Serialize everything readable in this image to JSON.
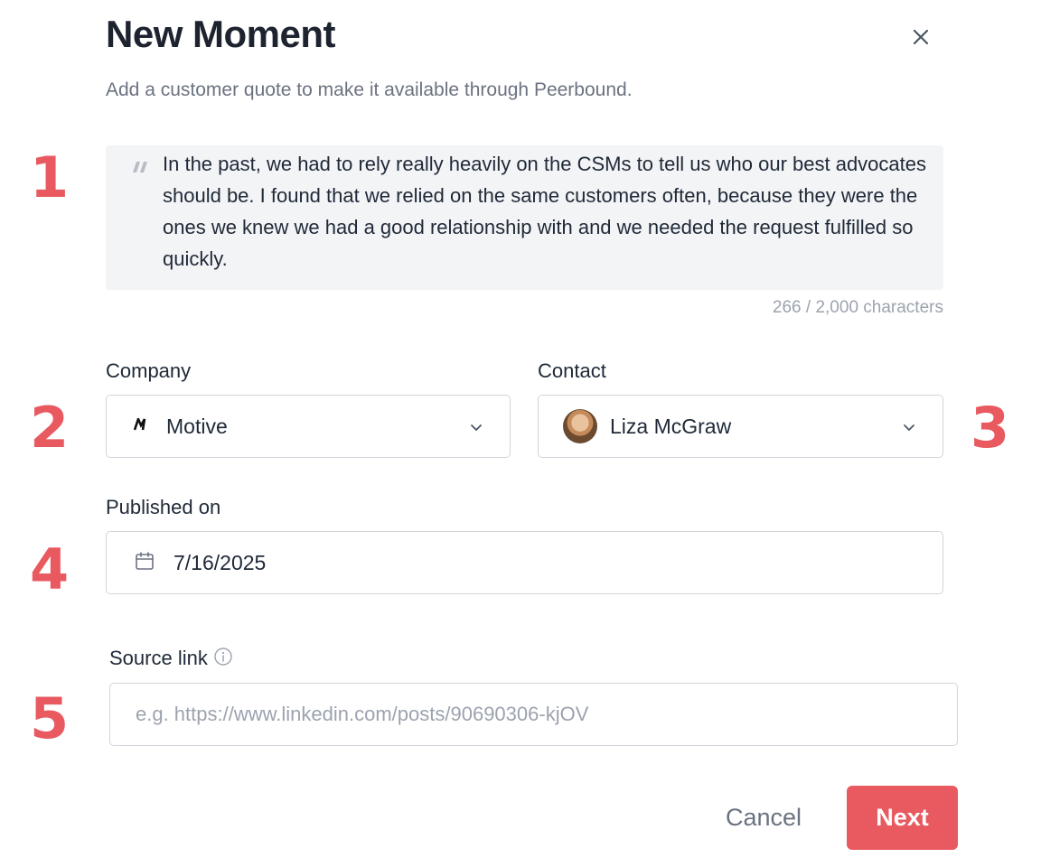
{
  "dialog": {
    "title": "New Moment",
    "subtitle": "Add a customer quote to make it available through Peerbound.",
    "close_icon": "close-icon"
  },
  "steps": [
    "1",
    "2",
    "3",
    "4",
    "5"
  ],
  "quote": {
    "mark": "\"",
    "text": "In the past, we had to rely really heavily on the CSMs to tell us who our best advocates should be. I found that we relied on the same customers often, because they were the ones we knew we had a good relationship with and we needed the request fulfilled so quickly.",
    "char_count": "266 / 2,000 characters"
  },
  "company": {
    "label": "Company",
    "logo_text": "M",
    "value": "Motive",
    "icon": "chevron-down-icon"
  },
  "contact": {
    "label": "Contact",
    "value": "Liza McGraw",
    "icon": "chevron-down-icon"
  },
  "published": {
    "label": "Published on",
    "value": "7/16/2025",
    "icon": "calendar-icon"
  },
  "source": {
    "label": "Source link",
    "placeholder": "e.g. https://www.linkedin.com/posts/90690306-kjOV",
    "value": "",
    "icon": "info-icon"
  },
  "actions": {
    "cancel_label": "Cancel",
    "next_label": "Next"
  },
  "colors": {
    "accent": "#e85a60",
    "title": "#1e2330",
    "muted": "#6b7280",
    "quote_bg": "#f3f4f6"
  }
}
